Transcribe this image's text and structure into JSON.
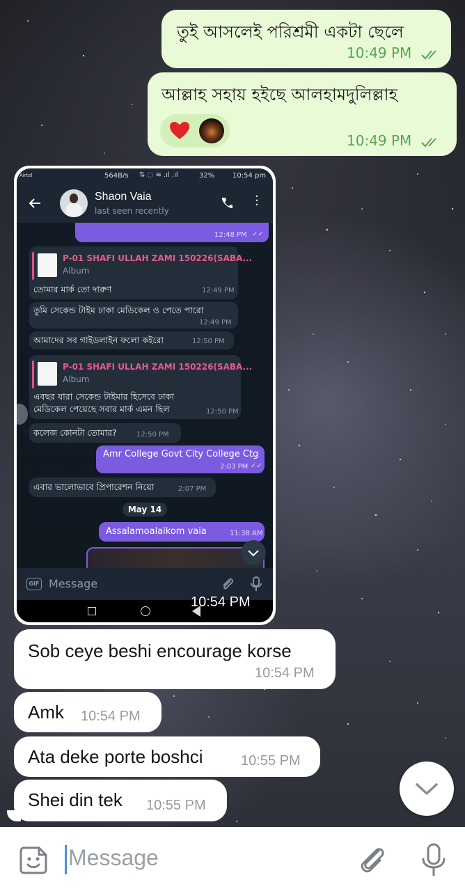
{
  "outgoing": [
    {
      "text": "তুই আসলেই পরিশ্রমী একটা ছেলে",
      "time": "10:49 PM"
    },
    {
      "text": "আল্লাহ সহায় হইছে আলহামদুলিল্লাহ",
      "time": "10:49 PM"
    }
  ],
  "screenshot": {
    "status_bar": {
      "carrier": "Airtel",
      "speed": "564B/s",
      "battery": "32%",
      "clock": "10:54 pm"
    },
    "contact_name": "Shaon Vaia",
    "last_seen": "last seen recently",
    "top_time": "12:48 PM",
    "reply_title": "P-01 SHAFI ULLAH ZAMI 150226(SABA...",
    "reply_sub": "Album",
    "messages": [
      {
        "text": "তোমার মার্ক তো দারুণ",
        "time": "12:49 PM"
      },
      {
        "text": "তুমি সেকেন্ড টাইম ঢাকা মেডিকেল ও পেতে পারো",
        "time": "12:49 PM"
      },
      {
        "text": "আমাদের সব গাইডলাইন ফলো কইরো",
        "time": "12:50 PM"
      },
      {
        "text_line1": "এবছর যারা সেকেন্ড টাইমার হিসেবে ঢাকা",
        "text_line2": "মেডিকেল পেয়েছে সবার মার্ক এমন ছিল",
        "time": "12:50 PM"
      },
      {
        "text": "কলেজ কোনটা তোমার?",
        "time": "12:50 PM"
      },
      {
        "text": "Amr College Govt City College Ctg",
        "time": "2:03 PM"
      },
      {
        "text": "এবার ভালোভাবে প্রিপারেশন নিয়ো",
        "time": "2:07 PM"
      },
      {
        "text": "Assalamoalaikom vaia",
        "time": "11:38 AM"
      }
    ],
    "date_chip": "May 14",
    "input_placeholder": "Message",
    "gif_label": "GIF",
    "overlay_time": "10:54 PM"
  },
  "incoming": [
    {
      "text": "Sob ceye beshi encourage korse",
      "time": "10:54 PM"
    },
    {
      "text": "Amk",
      "time": "10:54 PM"
    },
    {
      "text": "Ata deke porte boshci",
      "time": "10:55 PM"
    },
    {
      "text": "Shei din tek",
      "time": "10:55 PM"
    }
  ],
  "composer": {
    "placeholder": "Message"
  },
  "colors": {
    "outgoing_bubble": "#e8fbd6",
    "incoming_bubble": "#ffffff",
    "tick_green": "#5aa35a",
    "telegram_purple": "#7b5be0"
  }
}
